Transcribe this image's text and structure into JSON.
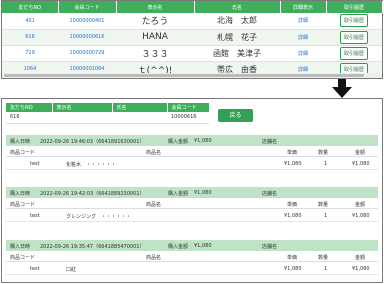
{
  "top_table": {
    "headers": [
      "友だちNO",
      "会員コード",
      "表示名",
      "氏名",
      "詳細表示",
      "取引履歴"
    ],
    "rows": [
      {
        "no": "401",
        "code": "10000000401",
        "display": "たろう",
        "name": "北海　太郎",
        "detail": "詳細",
        "history": "取引履歴"
      },
      {
        "no": "616",
        "code": "10000000616",
        "display": "HANA",
        "name": "札幌　花子",
        "detail": "詳細",
        "history": "取引履歴"
      },
      {
        "no": "729",
        "code": "10000000729",
        "display": "３３３",
        "name": "函館　美津子",
        "detail": "詳細",
        "history": "取引履歴"
      },
      {
        "no": "1064",
        "code": "10000001064",
        "display": "ｔ(^^)!",
        "name": "帯広　由香",
        "detail": "詳細",
        "history": "取引履歴"
      }
    ]
  },
  "member": {
    "headers": [
      "友だちNO",
      "表示名",
      "氏名",
      "会員コード"
    ],
    "values": [
      "616",
      "",
      "",
      "10000616"
    ],
    "back_label": "戻る"
  },
  "purchases": [
    {
      "date_label": "購入日時",
      "date": "2022-09-26 19:46:03（6641891630001）",
      "amount_label": "購入金額",
      "amount": "¥1,080",
      "store_label": "店舗名",
      "cols": [
        "商品コード",
        "商品名",
        "単価",
        "数量",
        "金額"
      ],
      "item": {
        "code": "test",
        "name": "化粧水　・・・・・・",
        "price": "¥1,080",
        "qty": "1",
        "total": "¥1,080"
      }
    },
    {
      "date_label": "購入日時",
      "date": "2022-09-26 19:42:03（6641889230001）",
      "amount_label": "購入金額",
      "amount": "¥1,080",
      "store_label": "店舗名",
      "cols": [
        "商品コード",
        "商品名",
        "単価",
        "数量",
        "金額"
      ],
      "item": {
        "code": "test",
        "name": "クレンジング　・・・・・・",
        "price": "¥1,080",
        "qty": "1",
        "total": "¥1,080"
      }
    },
    {
      "date_label": "購入日時",
      "date": "2022-09-26 19:35:47（6641885470001）",
      "amount_label": "購入金額",
      "amount": "¥1,080",
      "store_label": "店舗名",
      "cols": [
        "商品コード",
        "商品名",
        "単価",
        "数量",
        "金額"
      ],
      "item": {
        "code": "test",
        "name": "口紅",
        "price": "¥1,080",
        "qty": "1",
        "total": "¥1,080"
      }
    }
  ],
  "colors": {
    "header_green": "#3fae5a",
    "row_green": "#bfe3c6",
    "link_blue": "#2d6fd1",
    "button_green": "#33a152"
  },
  "icons": {
    "arrow": "arrow-down-icon"
  }
}
